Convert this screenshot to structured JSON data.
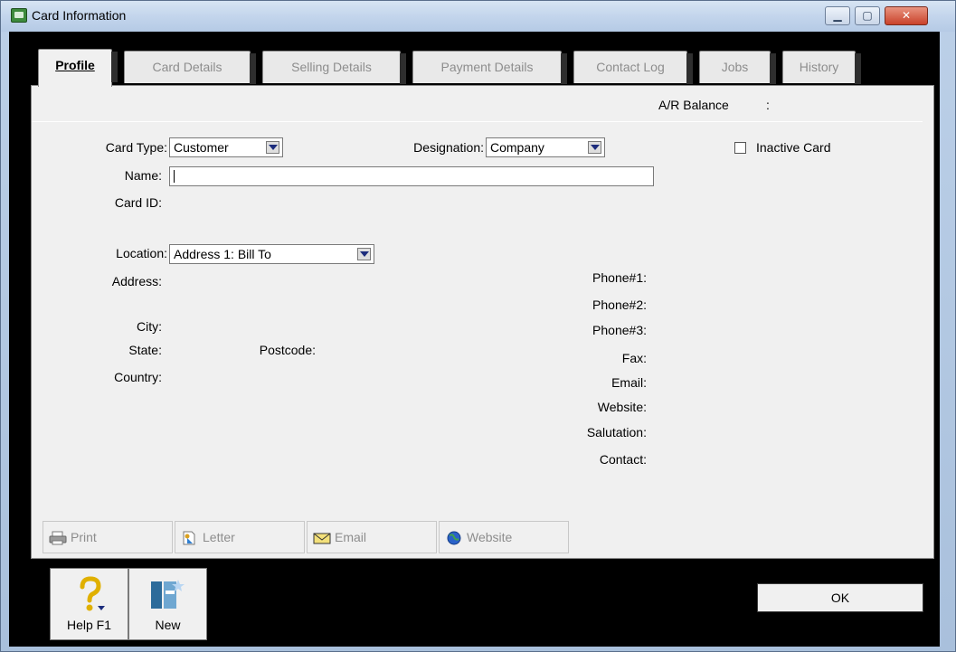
{
  "window": {
    "title": "Card Information",
    "controls": {
      "minimize": "▁",
      "maximize": "▢",
      "close": "✕"
    }
  },
  "tabs": [
    {
      "label": "Profile",
      "active": true
    },
    {
      "label": "Card Details",
      "active": false
    },
    {
      "label": "Selling Details",
      "active": false
    },
    {
      "label": "Payment Details",
      "active": false
    },
    {
      "label": "Contact Log",
      "active": false
    },
    {
      "label": "Jobs",
      "active": false
    },
    {
      "label": "History",
      "active": false
    }
  ],
  "profile": {
    "ar_balance_label": "A/R Balance",
    "ar_balance_sep": ":",
    "card_type_label": "Card Type:",
    "card_type_value": "Customer",
    "designation_label": "Designation:",
    "designation_value": "Company",
    "inactive_label": "Inactive Card",
    "name_label": "Name:",
    "name_value": "",
    "card_id_label": "Card ID:",
    "location_label": "Location:",
    "location_value": "Address 1:  Bill To",
    "address_label": "Address:",
    "city_label": "City:",
    "state_label": "State:",
    "postcode_label": "Postcode:",
    "country_label": "Country:",
    "phone1_label": "Phone#1:",
    "phone2_label": "Phone#2:",
    "phone3_label": "Phone#3:",
    "fax_label": "Fax:",
    "email_label": "Email:",
    "website_label": "Website:",
    "salutation_label": "Salutation:",
    "contact_label": "Contact:"
  },
  "actions": {
    "print": "Print",
    "letter": "Letter",
    "email": "Email",
    "website": "Website"
  },
  "footer": {
    "help": "Help F1",
    "new": "New",
    "ok": "OK"
  },
  "colors": {
    "accent_frame": "#000000",
    "panel": "#f0f0f0",
    "close_button": "#c9412a"
  }
}
